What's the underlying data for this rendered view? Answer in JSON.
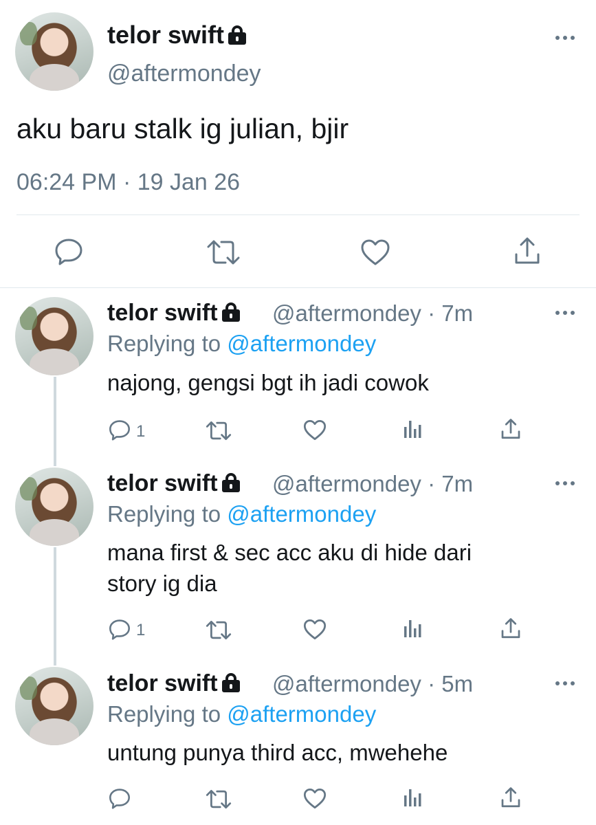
{
  "main_tweet": {
    "display_name": "telor swift",
    "handle": "@aftermondey",
    "text": "aku baru stalk ig julian, bjir",
    "timestamp": "06:24 PM · 19 Jan 26",
    "lock_icon": "lock-icon",
    "more_icon": "more-icon",
    "actions": [
      "reply-icon",
      "retweet-icon",
      "like-icon",
      "share-icon"
    ]
  },
  "replies": [
    {
      "display_name": "telor swift",
      "handle_time": "@aftermondey · 7m",
      "replying_prefix": "Replying to ",
      "replying_to": "@aftermondey",
      "text_lines": [
        "najong, gengsi bgt ih jadi cowok"
      ],
      "reply_count": "1"
    },
    {
      "display_name": "telor swift",
      "handle_time": "@aftermondey · 7m",
      "replying_prefix": "Replying to ",
      "replying_to": "@aftermondey",
      "text_lines": [
        "mana first & sec acc aku di hide dari",
        "story ig dia"
      ],
      "reply_count": "1"
    },
    {
      "display_name": "telor swift",
      "handle_time": "@aftermondey · 5m",
      "replying_prefix": "Replying to ",
      "replying_to": "@aftermondey",
      "text_lines": [
        "untung punya third acc, mwehehe"
      ],
      "reply_count": ""
    }
  ],
  "colors": {
    "text": "#14171a",
    "muted": "#657786",
    "link": "#1da1f2",
    "divider": "#e1e8ed"
  }
}
